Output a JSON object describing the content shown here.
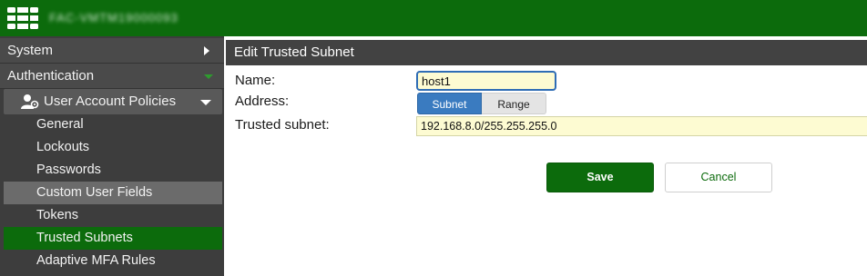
{
  "topbar": {
    "hostname": "FAC-VMTM19000093",
    "brand_color": "#0c6b0c"
  },
  "sidebar": {
    "system": "System",
    "authentication": "Authentication",
    "user_account_policies": "User Account Policies",
    "items": [
      "General",
      "Lockouts",
      "Passwords",
      "Custom User Fields",
      "Tokens",
      "Trusted Subnets",
      "Adaptive MFA Rules"
    ],
    "active_item": "Trusted Subnets"
  },
  "panel": {
    "title": "Edit Trusted Subnet",
    "name_label": "Name:",
    "name_value": "host1",
    "address_label": "Address:",
    "address_options": [
      "Subnet",
      "Range"
    ],
    "address_selected": "Subnet",
    "subnet_label": "Trusted subnet:",
    "subnet_value": "192.168.8.0/255.255.255.0",
    "save_label": "Save",
    "cancel_label": "Cancel"
  }
}
